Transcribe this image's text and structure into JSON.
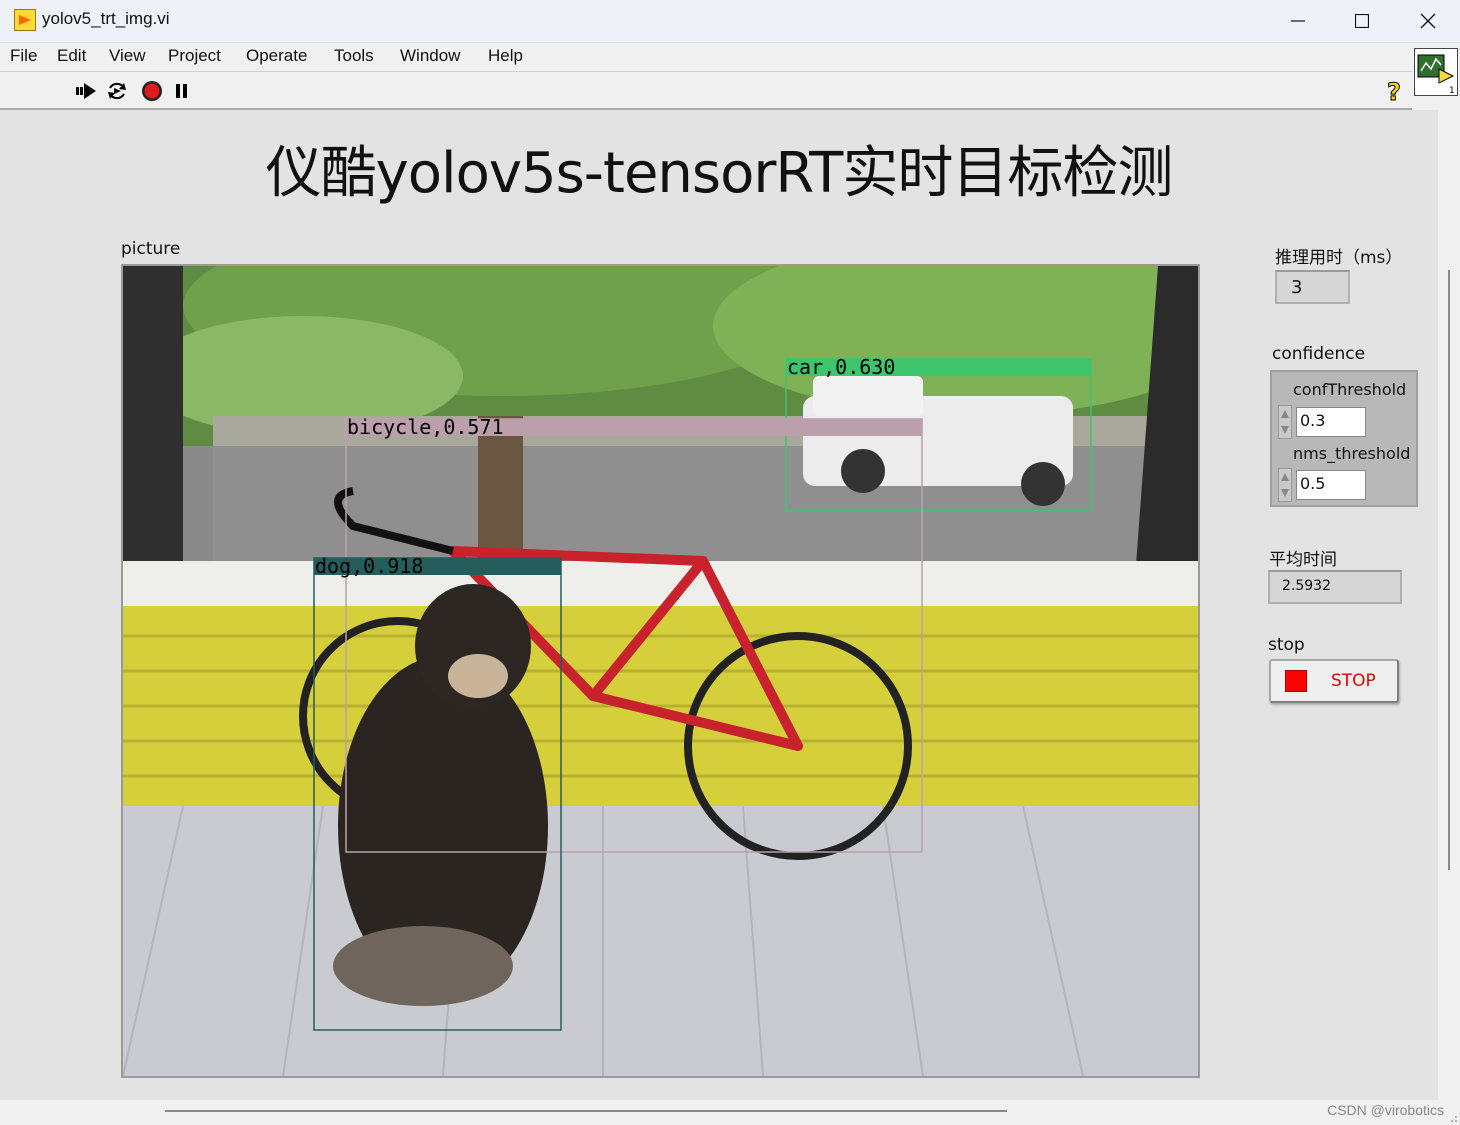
{
  "window": {
    "title": "yolov5_trt_img.vi",
    "controls": [
      "minimize",
      "maximize",
      "close"
    ]
  },
  "menu": [
    "File",
    "Edit",
    "View",
    "Project",
    "Operate",
    "Tools",
    "Window",
    "Help"
  ],
  "toolbar": {
    "icons": [
      "run-arrow-icon",
      "run-continuously-icon",
      "abort-icon",
      "pause-icon",
      "help-icon"
    ]
  },
  "panel": {
    "title": "仪酷yolov5s-tensorRT实时目标检测",
    "picture_label": "picture",
    "detections": [
      {
        "label": "car,0.630",
        "color": "#3ec46c"
      },
      {
        "label": "bicycle,0.571",
        "color": "#bba0ab"
      },
      {
        "label": "dog,0.918",
        "color": "#255c5c"
      }
    ],
    "inference_time": {
      "label": "推理用时（ms）",
      "value": "3"
    },
    "confidence": {
      "label": "confidence",
      "conf_threshold": {
        "label": "confThreshold",
        "value": "0.3"
      },
      "nms_threshold": {
        "label": "nms_threshold",
        "value": "0.5"
      }
    },
    "average_time": {
      "label": "平均时间",
      "value": "2.5932"
    },
    "stop": {
      "label": "stop",
      "button": "STOP"
    }
  },
  "watermark": "CSDN @virobotics"
}
